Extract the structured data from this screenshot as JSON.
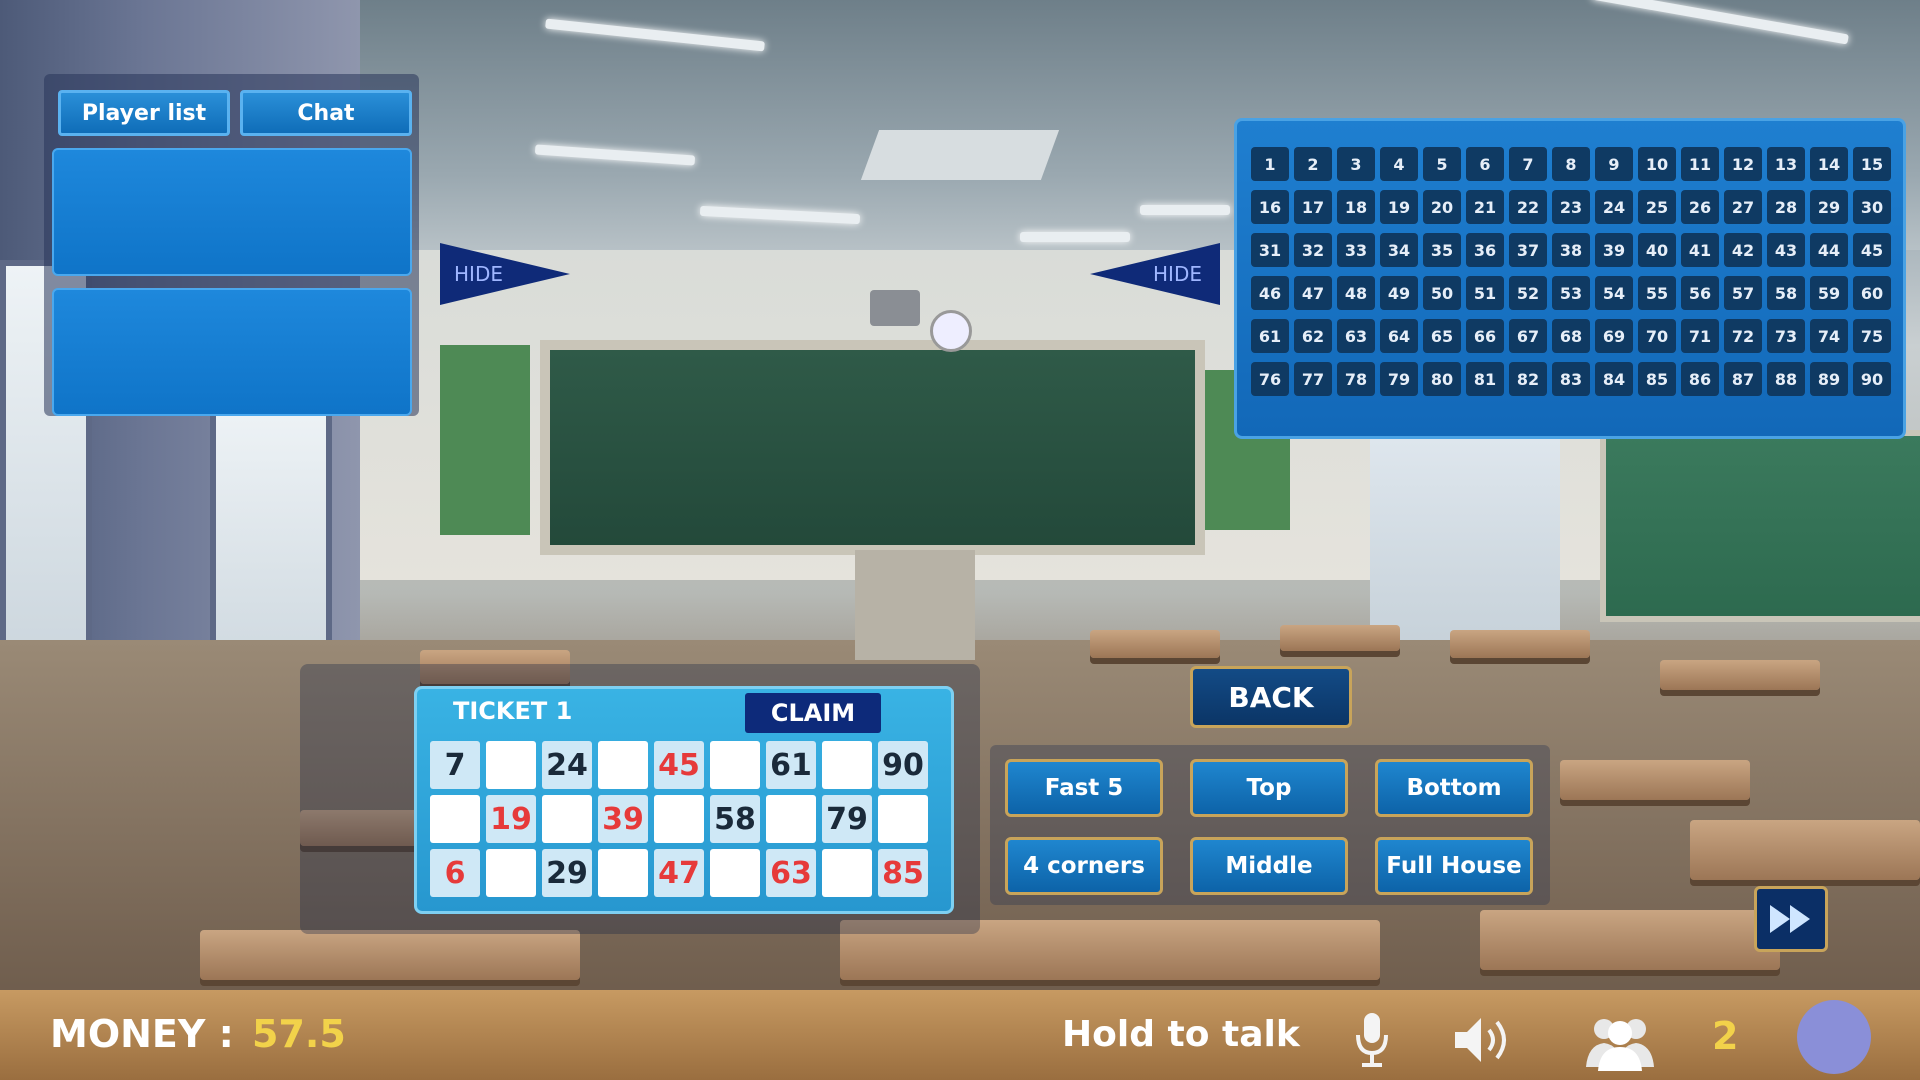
{
  "tabs": {
    "player_list": "Player list",
    "chat": "Chat"
  },
  "hide_left": "HIDE",
  "hide_right": "HIDE",
  "numbers": [
    1,
    2,
    3,
    4,
    5,
    6,
    7,
    8,
    9,
    10,
    11,
    12,
    13,
    14,
    15,
    16,
    17,
    18,
    19,
    20,
    21,
    22,
    23,
    24,
    25,
    26,
    27,
    28,
    29,
    30,
    31,
    32,
    33,
    34,
    35,
    36,
    37,
    38,
    39,
    40,
    41,
    42,
    43,
    44,
    45,
    46,
    47,
    48,
    49,
    50,
    51,
    52,
    53,
    54,
    55,
    56,
    57,
    58,
    59,
    60,
    61,
    62,
    63,
    64,
    65,
    66,
    67,
    68,
    69,
    70,
    71,
    72,
    73,
    74,
    75,
    76,
    77,
    78,
    79,
    80,
    81,
    82,
    83,
    84,
    85,
    86,
    87,
    88,
    89,
    90
  ],
  "ticket": {
    "title": "TICKET 1",
    "claim_label": "CLAIM",
    "rows": [
      [
        {
          "v": "7",
          "c": "dark"
        },
        {
          "v": ""
        },
        {
          "v": "24",
          "c": "dark"
        },
        {
          "v": ""
        },
        {
          "v": "45",
          "c": "red"
        },
        {
          "v": ""
        },
        {
          "v": "61",
          "c": "dark"
        },
        {
          "v": ""
        },
        {
          "v": "90",
          "c": "dark"
        }
      ],
      [
        {
          "v": ""
        },
        {
          "v": "19",
          "c": "red"
        },
        {
          "v": ""
        },
        {
          "v": "39",
          "c": "red"
        },
        {
          "v": ""
        },
        {
          "v": "58",
          "c": "dark"
        },
        {
          "v": ""
        },
        {
          "v": "79",
          "c": "dark"
        },
        {
          "v": ""
        }
      ],
      [
        {
          "v": "6",
          "c": "red"
        },
        {
          "v": ""
        },
        {
          "v": "29",
          "c": "dark"
        },
        {
          "v": ""
        },
        {
          "v": "47",
          "c": "red"
        },
        {
          "v": ""
        },
        {
          "v": "63",
          "c": "red"
        },
        {
          "v": ""
        },
        {
          "v": "85",
          "c": "red"
        }
      ]
    ]
  },
  "buttons": {
    "back": "BACK",
    "fast5": "Fast 5",
    "top": "Top",
    "bottom": "Bottom",
    "corners": "4 corners",
    "middle": "Middle",
    "full_house": "Full House"
  },
  "bottom": {
    "money_label": "MONEY :",
    "money_value": "57.5",
    "talk_label": "Hold to talk",
    "player_count": "2"
  },
  "icons": [
    "microphone-icon",
    "speaker-icon",
    "players-icon",
    "fast-forward-icon"
  ],
  "colors": {
    "accent": "#1f7fd0",
    "gold": "#f2d24a",
    "red_number": "#e63a3a",
    "dark_navy": "#0d2a7a"
  }
}
